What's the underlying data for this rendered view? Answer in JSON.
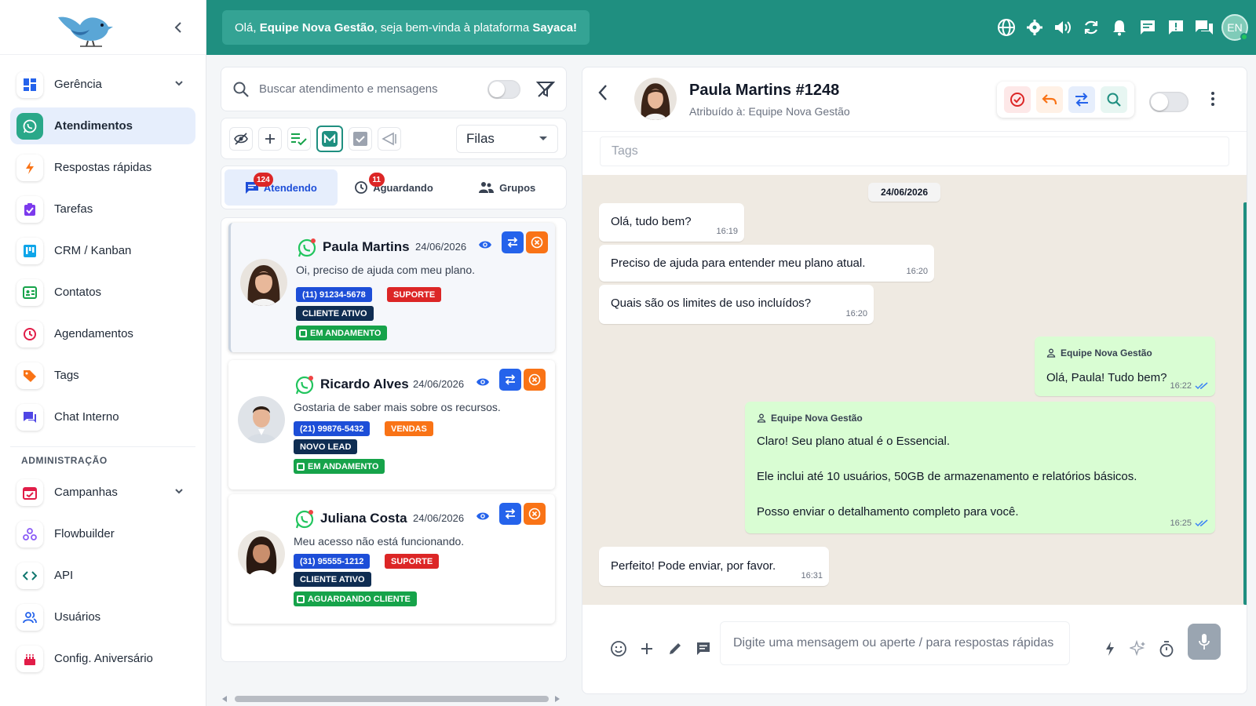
{
  "sidebar": {
    "collapse_icon": "chevron-left-icon",
    "items": [
      {
        "label": "Gerência",
        "icon": "dashboard-icon",
        "has_chevron": true
      },
      {
        "label": "Atendimentos",
        "icon": "whatsapp-icon",
        "active": true
      },
      {
        "label": "Respostas rápidas",
        "icon": "lightning-icon"
      },
      {
        "label": "Tarefas",
        "icon": "clipboard-check-icon"
      },
      {
        "label": "CRM / Kanban",
        "icon": "kanban-icon"
      },
      {
        "label": "Contatos",
        "icon": "contacts-icon"
      },
      {
        "label": "Agendamentos",
        "icon": "clock-icon"
      },
      {
        "label": "Tags",
        "icon": "tag-icon"
      },
      {
        "label": "Chat Interno",
        "icon": "chat-icon"
      }
    ],
    "admin_heading": "ADMINISTRAÇÃO",
    "admin_items": [
      {
        "label": "Campanhas",
        "icon": "calendar-icon",
        "has_chevron": true
      },
      {
        "label": "Flowbuilder",
        "icon": "flow-icon"
      },
      {
        "label": "API",
        "icon": "code-icon"
      },
      {
        "label": "Usuários",
        "icon": "users-icon"
      },
      {
        "label": "Config. Aniversário",
        "icon": "cake-icon"
      }
    ]
  },
  "topbar": {
    "welcome_prefix": "Olá,",
    "welcome_team": "Equipe Nova Gestão",
    "welcome_middle": ", seja bem-vinda à plataforma",
    "welcome_platform": "Sayaca!",
    "icons": [
      "globe-icon",
      "settings-icon",
      "volume-icon",
      "refresh-icon",
      "bell-icon",
      "message-icon",
      "alert-message-icon",
      "chats-icon"
    ],
    "avatar_initials": "EN",
    "colors": {
      "bar": "#1f8f80",
      "welcome_bg": "#34a394"
    }
  },
  "list": {
    "search_placeholder": "Buscar atendimento e mensagens",
    "queue_select": "Filas",
    "tabs": [
      {
        "label": "Atendendo",
        "badge": "124",
        "icon": "chat-icon"
      },
      {
        "label": "Aguardando",
        "badge": "11",
        "icon": "clock-icon"
      },
      {
        "label": "Grupos",
        "badge": "",
        "icon": "group-icon"
      }
    ],
    "tickets": [
      {
        "name": "Paula Martins",
        "date": "24/06/2026",
        "message": "Oi, preciso de ajuda com meu plano.",
        "phone": "(11) 91234-5678",
        "queue": "SUPORTE",
        "status_tag": "CLIENTE ATIVO",
        "state": "EM ANDAMENTO"
      },
      {
        "name": "Ricardo Alves",
        "date": "24/06/2026",
        "message": "Gostaria de saber mais sobre os recursos.",
        "phone": "(21) 99876-5432",
        "queue": "VENDAS",
        "status_tag": "NOVO LEAD",
        "state": "EM ANDAMENTO"
      },
      {
        "name": "Juliana Costa",
        "date": "24/06/2026",
        "message": "Meu acesso não está funcionando.",
        "phone": "(31) 95555-1212",
        "queue": "SUPORTE",
        "status_tag": "CLIENTE ATIVO",
        "state": "AGUARDANDO CLIENTE"
      }
    ]
  },
  "chat": {
    "contact_name": "Paula Martins #1248",
    "assigned": "Atribuído à: Equipe Nova Gestão",
    "tags_placeholder": "Tags",
    "date_divider": "24/06/2026",
    "messages": [
      {
        "dir": "in",
        "text": "Olá, tudo bem?",
        "time": "16:19"
      },
      {
        "dir": "in",
        "text": "Preciso de ajuda para entender meu plano atual.",
        "time": "16:20"
      },
      {
        "dir": "in",
        "text": "Quais são os limites de uso incluídos?",
        "time": "16:20"
      },
      {
        "dir": "out",
        "sender": "Equipe Nova Gestão",
        "text": "Olá, Paula! Tudo bem?",
        "time": "16:22"
      },
      {
        "dir": "out",
        "sender": "Equipe Nova Gestão",
        "lines": [
          "Claro! Seu plano atual é o Essencial.",
          "Ele inclui até 10 usuários, 50GB de armazenamento e relatórios básicos.",
          "Posso enviar o detalhamento completo para você."
        ],
        "time": "16:25"
      },
      {
        "dir": "in",
        "text": "Perfeito! Pode enviar, por favor.",
        "time": "16:31"
      }
    ],
    "composer_placeholder": "Digite uma mensagem ou aperte / para respostas rápidas"
  }
}
